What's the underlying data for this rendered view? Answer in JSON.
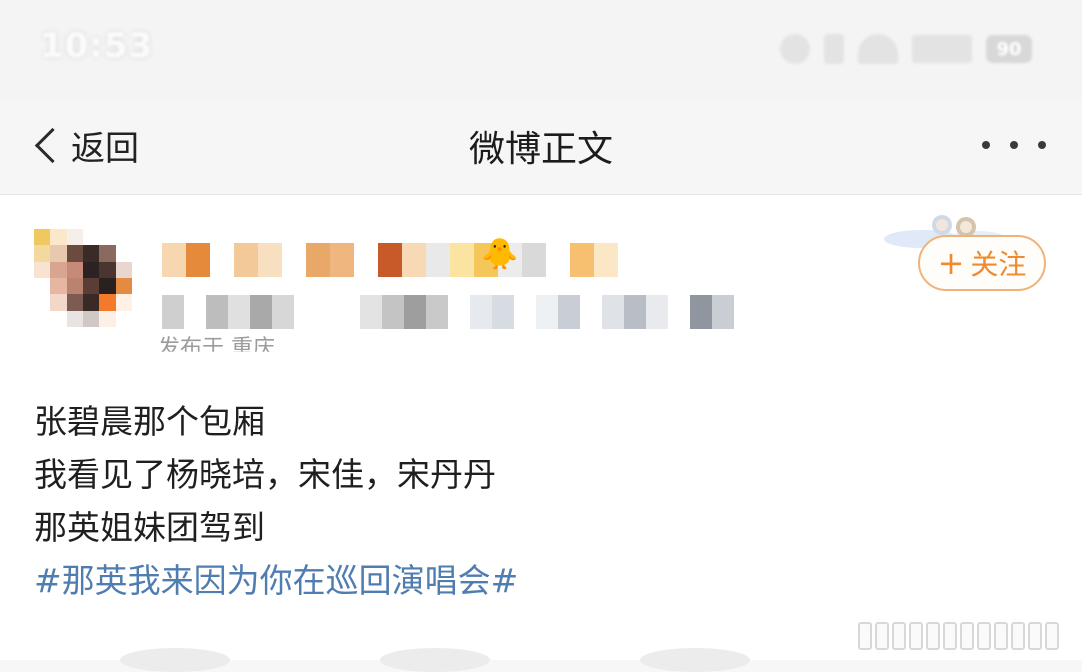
{
  "status_bar": {
    "time": "10:53",
    "battery": "90"
  },
  "nav": {
    "back_label": "返回",
    "title": "微博正文"
  },
  "post": {
    "source_text": "发布于 重庆",
    "follow_label": "关注",
    "lines": [
      "张碧晨那个包厢",
      "我看见了杨晓培，宋佳，宋丹丹",
      "那英姐妹团驾到"
    ],
    "hashtag": "#那英我来因为你在巡回演唱会#"
  },
  "colors": {
    "accent_orange": "#f08a2e",
    "follow_border": "#efb37a",
    "hashtag_blue": "#507daf",
    "text_dark": "#1f1f1f"
  },
  "icons": {
    "back": "chevron-left-icon",
    "more": "more-dots-icon",
    "follow_plus": "plus-icon"
  }
}
